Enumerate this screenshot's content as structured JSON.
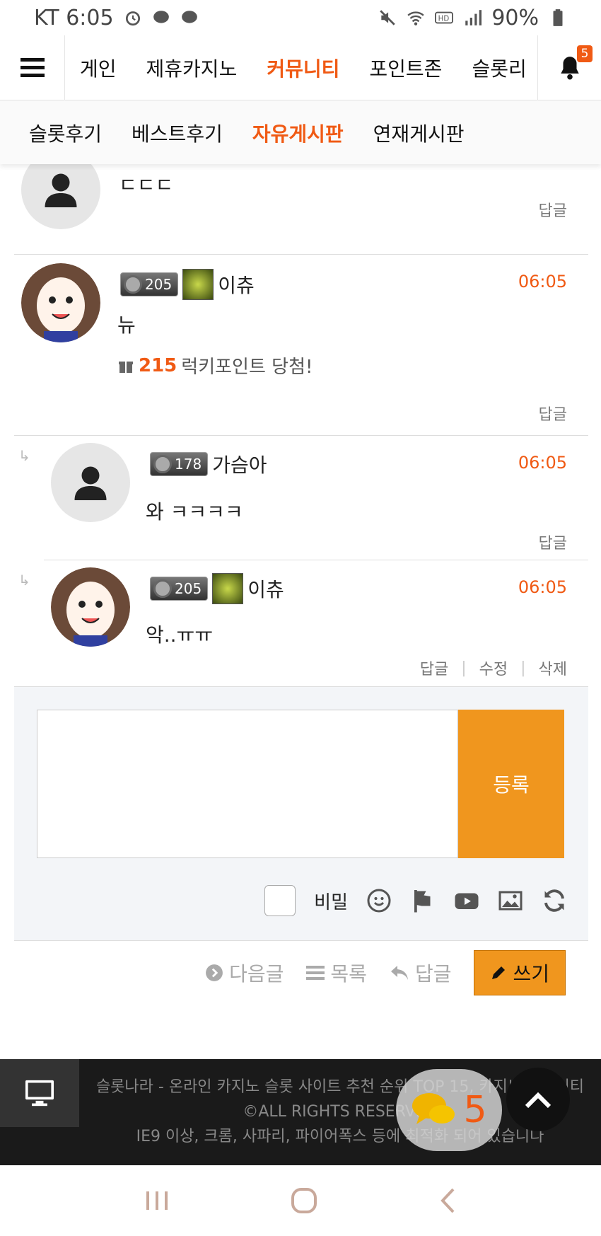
{
  "statusbar": {
    "carrier_time": "KT 6:05",
    "battery": "90%"
  },
  "mainnav": {
    "items": [
      "게인",
      "제휴카지노",
      "커뮤니티",
      "포인트존",
      "슬롯리"
    ],
    "active_index": 2,
    "bell_count": "5"
  },
  "subnav": {
    "items": [
      "슬롯후기",
      "베스트후기",
      "자유게시판",
      "연재게시판"
    ],
    "active_index": 2
  },
  "comments": [
    {
      "level": "",
      "name": "",
      "time": "",
      "body": "ㄷㄷㄷ",
      "reply": "답글"
    },
    {
      "level": "205",
      "name": "이츄",
      "time": "06:05",
      "body": "뉴",
      "lucky_points": "215",
      "lucky_text": "럭키포인트 당첨!",
      "reply": "답글"
    },
    {
      "level": "178",
      "name": "가슴아",
      "time": "06:05",
      "body": "와 ㅋㅋㅋㅋ",
      "reply": "답글"
    },
    {
      "level": "205",
      "name": "이츄",
      "time": "06:05",
      "body": "악..ㅠㅠ",
      "reply": "답글",
      "edit": "수정",
      "delete": "삭제"
    }
  ],
  "writebox": {
    "submit_label": "등록",
    "secret_label": "비밀"
  },
  "actions": {
    "next": "다음글",
    "list": "목록",
    "reply": "답글",
    "write": "쓰기"
  },
  "footer": {
    "line1": "슬롯나라 - 온라인 카지노 슬롯 사이트 추천 순위 TOP 15, 카지노 커뮤니티",
    "line2": "©ALL RIGHTS RESERVED",
    "line3": "IE9 이상, 크롬, 사파리, 파이어폭스 등에 최적화 되어 있습니다",
    "chat_count": "5"
  },
  "colors": {
    "accent": "#f05a14",
    "button": "#f0961e"
  }
}
